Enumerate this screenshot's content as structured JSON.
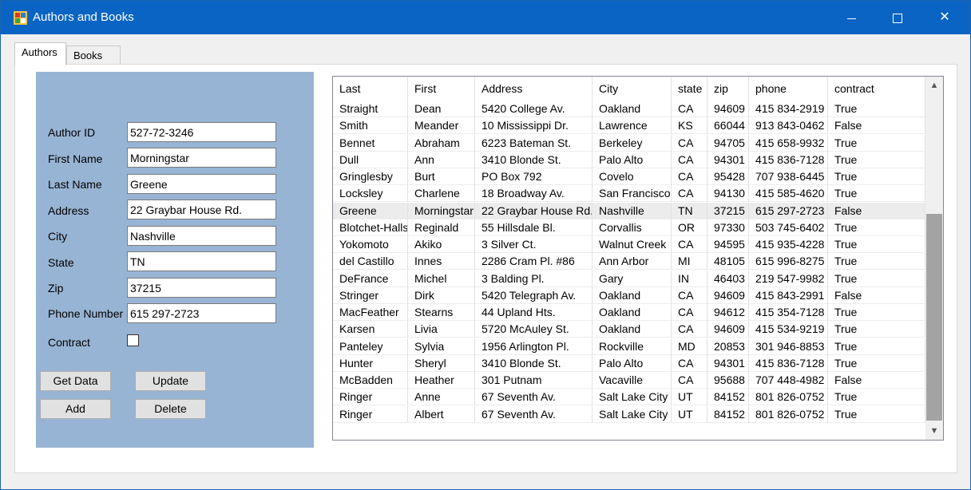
{
  "window": {
    "title": "Authors and Books",
    "minimize_glyph": "",
    "maximize_glyph": "",
    "close_glyph": "✕"
  },
  "tabs": [
    {
      "label": "Authors"
    },
    {
      "label": "Books"
    }
  ],
  "form": {
    "author_id_label": "Author ID",
    "author_id_value": "527-72-3246",
    "first_name_label": "First Name",
    "first_name_value": "Morningstar",
    "last_name_label": "Last Name",
    "last_name_value": "Greene",
    "address_label": "Address",
    "address_value": "22 Graybar House Rd.",
    "city_label": "City",
    "city_value": "Nashville",
    "state_label": "State",
    "state_value": "TN",
    "zip_label": "Zip",
    "zip_value": "37215",
    "phone_label": "Phone Number",
    "phone_value": "615 297-2723",
    "contract_label": "Contract",
    "contract_checked": false
  },
  "buttons": {
    "get_data": "Get Data",
    "update": "Update",
    "add": "Add",
    "delete": "Delete"
  },
  "grid": {
    "columns": [
      "Last",
      "First",
      "Address",
      "City",
      "state",
      "zip",
      "phone",
      "contract"
    ],
    "rows": [
      [
        "Straight",
        "Dean",
        "5420 College Av.",
        "Oakland",
        "CA",
        "94609",
        "415 834-2919",
        "True"
      ],
      [
        "Smith",
        "Meander",
        "10 Mississippi Dr.",
        "Lawrence",
        "KS",
        "66044",
        "913 843-0462",
        "False"
      ],
      [
        "Bennet",
        "Abraham",
        "6223 Bateman St.",
        "Berkeley",
        "CA",
        "94705",
        "415 658-9932",
        "True"
      ],
      [
        "Dull",
        "Ann",
        "3410 Blonde St.",
        "Palo Alto",
        "CA",
        "94301",
        "415 836-7128",
        "True"
      ],
      [
        "Gringlesby",
        "Burt",
        "PO Box 792",
        "Covelo",
        "CA",
        "95428",
        "707 938-6445",
        "True"
      ],
      [
        "Locksley",
        "Charlene",
        "18 Broadway Av.",
        "San Francisco",
        "CA",
        "94130",
        "415 585-4620",
        "True"
      ],
      [
        "Greene",
        "Morningstar",
        "22 Graybar House Rd.",
        "Nashville",
        "TN",
        "37215",
        "615 297-2723",
        "False"
      ],
      [
        "Blotchet-Halls",
        "Reginald",
        "55 Hillsdale Bl.",
        "Corvallis",
        "OR",
        "97330",
        "503 745-6402",
        "True"
      ],
      [
        "Yokomoto",
        "Akiko",
        "3 Silver Ct.",
        "Walnut Creek",
        "CA",
        "94595",
        "415 935-4228",
        "True"
      ],
      [
        "del Castillo",
        "Innes",
        "2286 Cram Pl. #86",
        "Ann Arbor",
        "MI",
        "48105",
        "615 996-8275",
        "True"
      ],
      [
        "DeFrance",
        "Michel",
        "3 Balding Pl.",
        "Gary",
        "IN",
        "46403",
        "219 547-9982",
        "True"
      ],
      [
        "Stringer",
        "Dirk",
        "5420 Telegraph Av.",
        "Oakland",
        "CA",
        "94609",
        "415 843-2991",
        "False"
      ],
      [
        "MacFeather",
        "Stearns",
        "44 Upland Hts.",
        "Oakland",
        "CA",
        "94612",
        "415 354-7128",
        "True"
      ],
      [
        "Karsen",
        "Livia",
        "5720 McAuley St.",
        "Oakland",
        "CA",
        "94609",
        "415 534-9219",
        "True"
      ],
      [
        "Panteley",
        "Sylvia",
        "1956 Arlington Pl.",
        "Rockville",
        "MD",
        "20853",
        "301 946-8853",
        "True"
      ],
      [
        "Hunter",
        "Sheryl",
        "3410 Blonde St.",
        "Palo Alto",
        "CA",
        "94301",
        "415 836-7128",
        "True"
      ],
      [
        "McBadden",
        "Heather",
        "301 Putnam",
        "Vacaville",
        "CA",
        "95688",
        "707 448-4982",
        "False"
      ],
      [
        "Ringer",
        "Anne",
        "67 Seventh Av.",
        "Salt Lake City",
        "UT",
        "84152",
        "801 826-0752",
        "True"
      ],
      [
        "Ringer",
        "Albert",
        "67 Seventh Av.",
        "Salt Lake City",
        "UT",
        "84152",
        "801 826-0752",
        "True"
      ]
    ],
    "selected_row": 6
  },
  "colors": {
    "titlebar": "#0a64c4",
    "panel": "#98b4d4",
    "selected_row": "#ececec"
  },
  "icons": {
    "app": "app-grid-icon",
    "scroll_up": "chevron-up-icon",
    "scroll_down": "chevron-down-icon"
  }
}
